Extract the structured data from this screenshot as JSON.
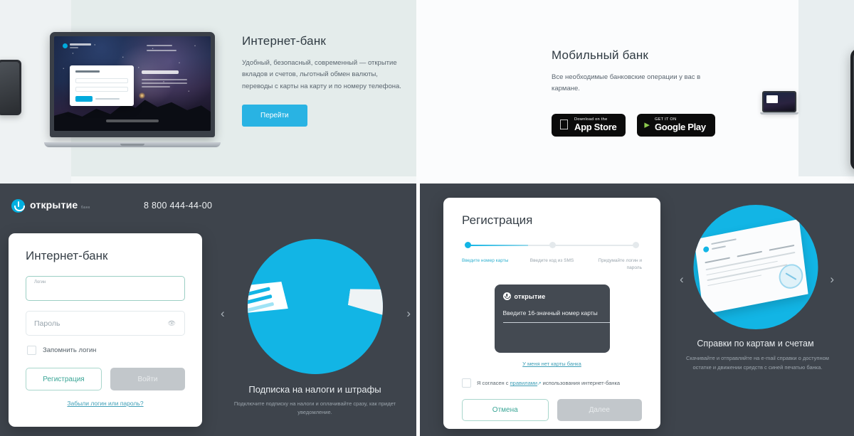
{
  "promo_internet_bank": {
    "title": "Интернет-банк",
    "body": "Удобный, безопасный, современный — открытие вкладов и счетов, льготный обмен валюты, переводы с карты на карту и по номеру телефона.",
    "cta_label": "Перейти"
  },
  "promo_mobile_bank": {
    "title": "Мобильный банк",
    "body": "Все необходимые банковские операции у вас в кармане.",
    "app_store": {
      "small": "Download on the",
      "big": "App Store"
    },
    "google_play": {
      "small": "GET IT ON",
      "big": "Google Play"
    }
  },
  "login_panel": {
    "brand_name": "открытие",
    "brand_sub": "банк",
    "phone": "8 800 444-44-00",
    "card_title": "Интернет-банк",
    "login_field": {
      "label": "Логин",
      "value": ""
    },
    "password_field": {
      "placeholder": "Пароль",
      "value": "",
      "eye_icon": "eye-icon"
    },
    "remember_label": "Запомнить логин",
    "register_button": "Регистрация",
    "submit_button": "Войти",
    "forgot_link": "Забыли логин или пароль?"
  },
  "carousel_left": {
    "title": "Подписка на налоги и штрафы",
    "body": "Подключите подписку на налоги и оплачивайте сразу, как придет уведомление.",
    "prev_icon": "chevron-left-icon",
    "next_icon": "chevron-right-icon"
  },
  "registration_panel": {
    "title": "Регистрация",
    "steps": [
      {
        "label": "Введите\nномер карты",
        "active": true
      },
      {
        "label": "Введите код\nиз SMS",
        "active": false
      },
      {
        "label": "Придумайте\nлогин и пароль",
        "active": false
      }
    ],
    "step_labels": [
      "Введите номер карты",
      "Введите код из SMS",
      "Придумайте логин и пароль"
    ],
    "card_mock": {
      "brand": "открытие",
      "hint": "Введите 16-значный номер карты",
      "value": ""
    },
    "no_card_link": "У меня нет карты банка",
    "agree_prefix": "Я согласен с ",
    "agree_link": "правилами",
    "agree_ext_icon": "external-link-icon",
    "agree_suffix": " использования интернет-банка",
    "cancel_button": "Отмена",
    "next_button": "Далее"
  },
  "carousel_right": {
    "title": "Справки по картам и счетам",
    "body": "Скачивайте и отправляйте на e-mail справки о доступном остатке и движении средств с синей печатью банка.",
    "prev_icon": "chevron-left-icon",
    "next_icon": "chevron-right-icon"
  },
  "colors": {
    "accent_blue": "#12b5e5",
    "cta_blue": "#29b3e3",
    "teal": "#3aa596",
    "panel_dark": "#3e444c",
    "link": "#3f9fb7"
  }
}
